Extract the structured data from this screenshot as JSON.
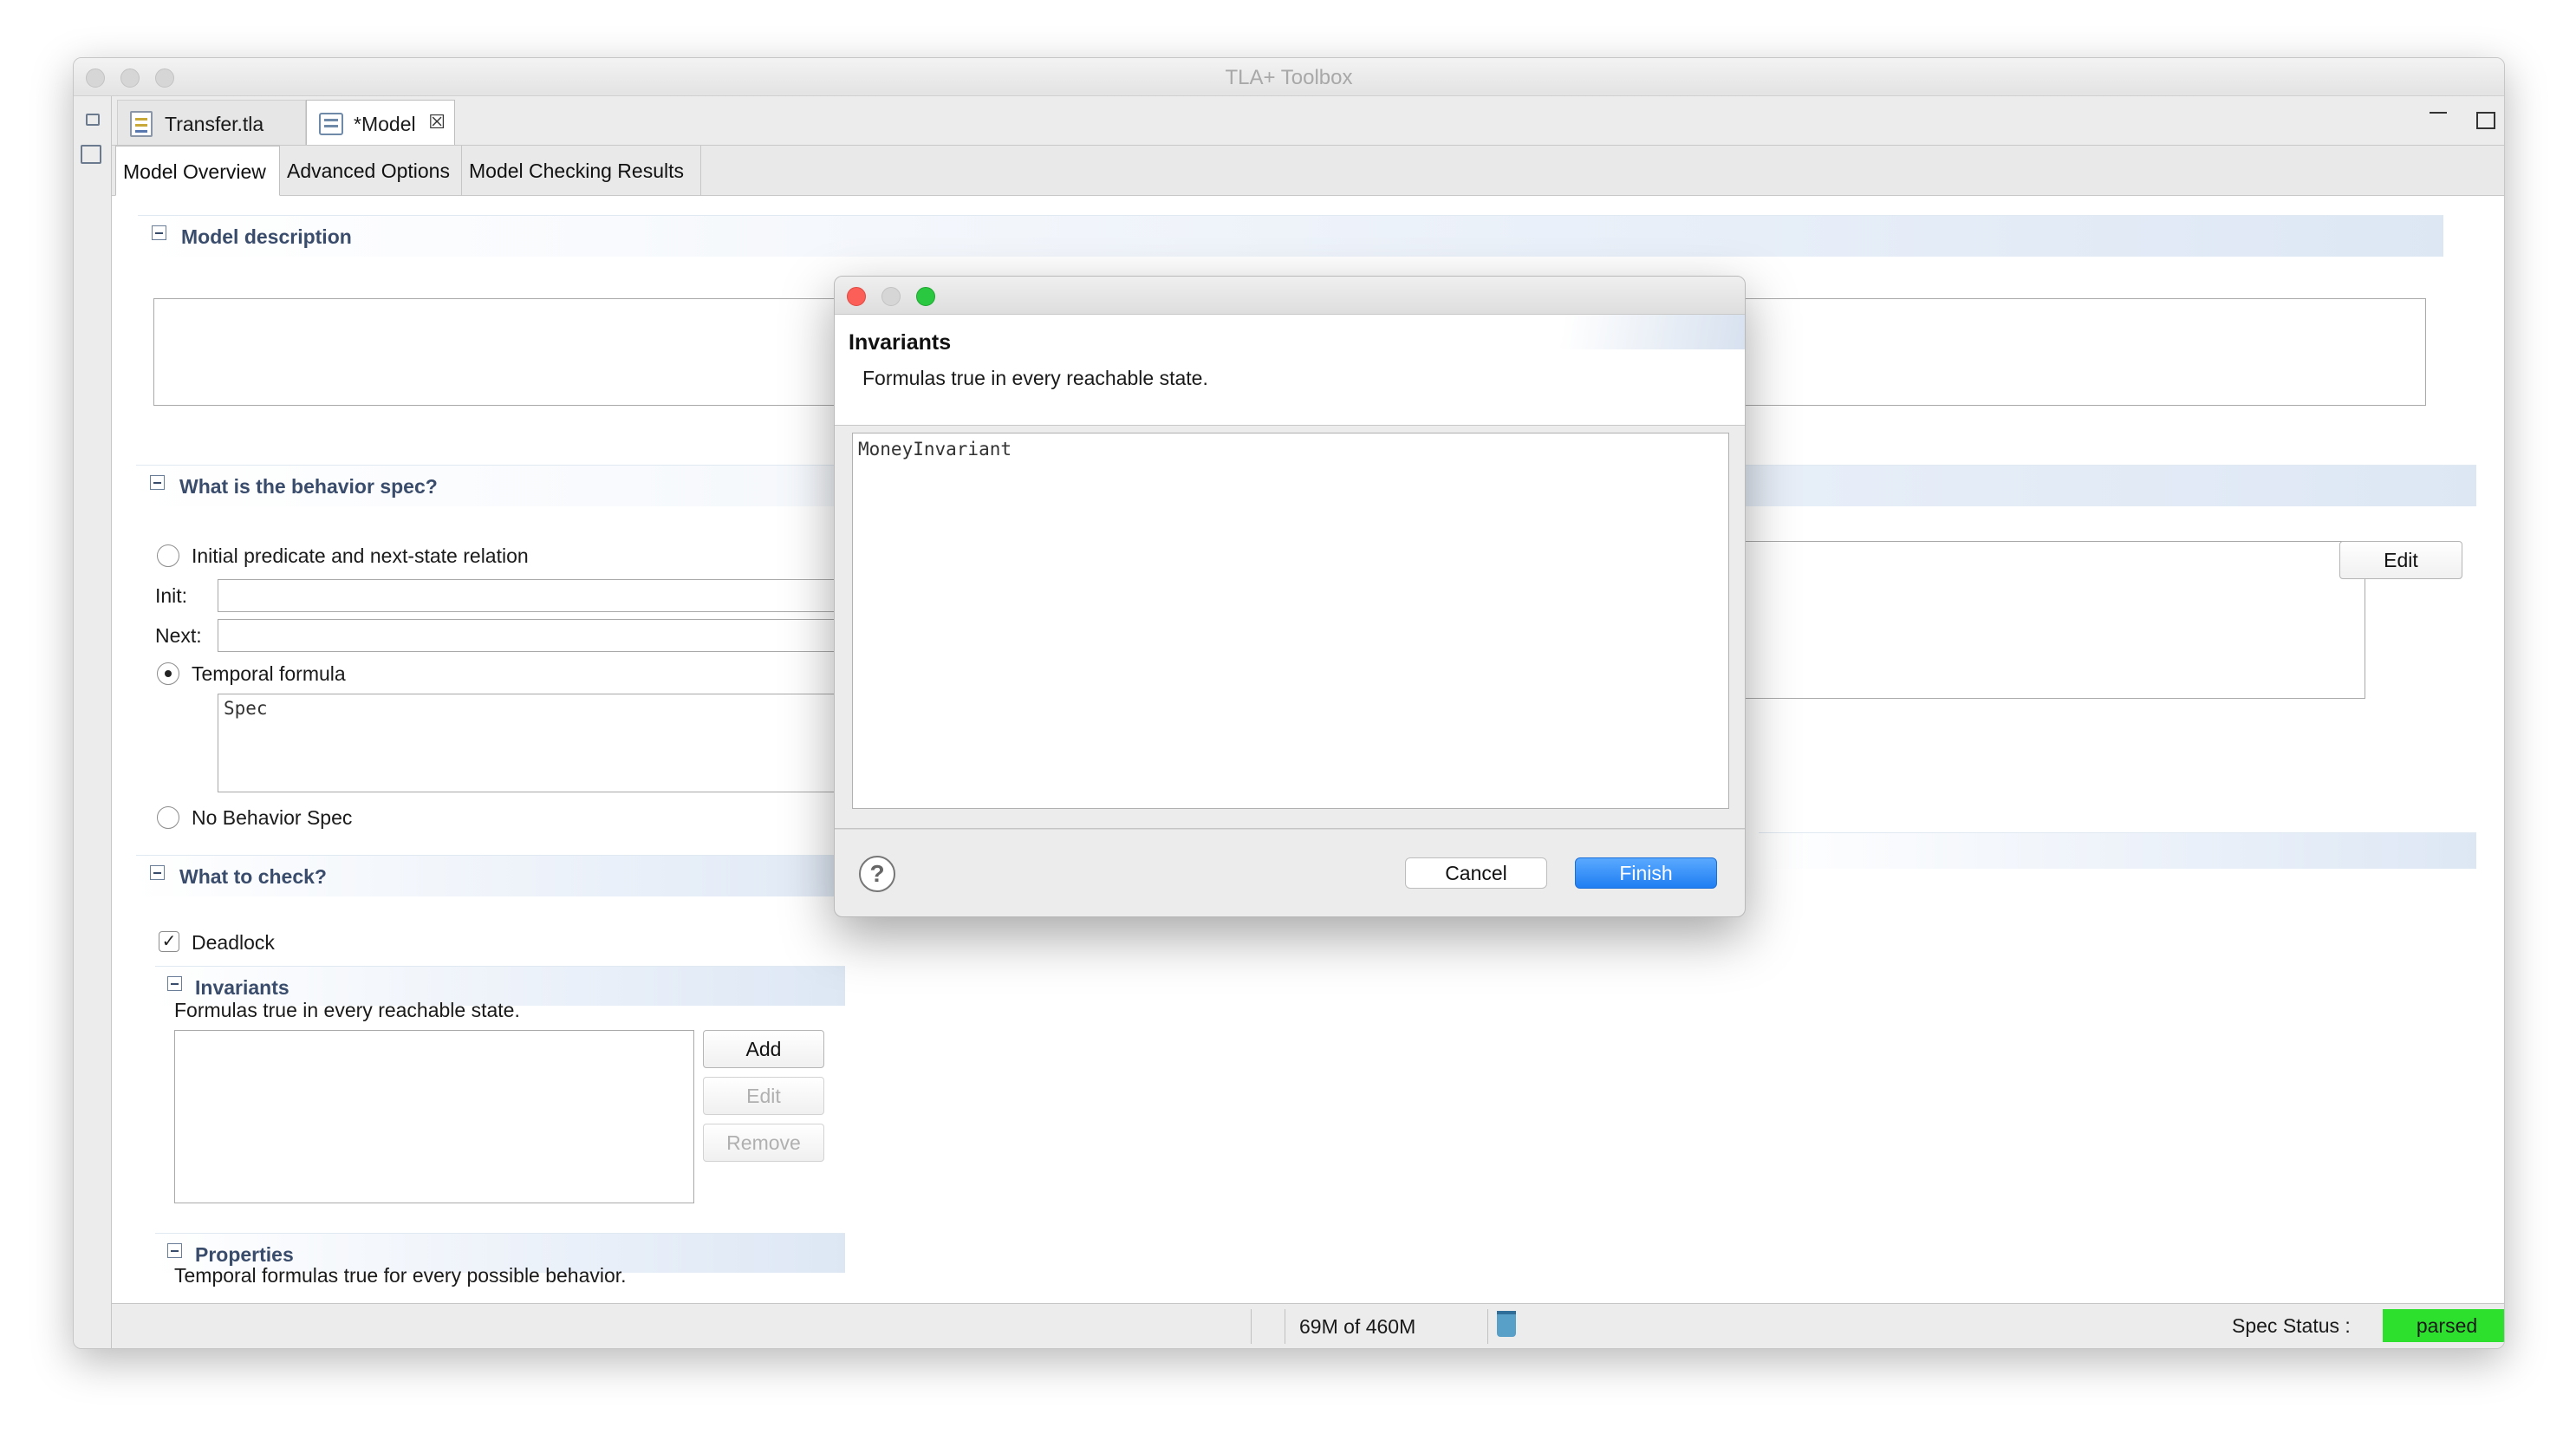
{
  "app": {
    "window_title": "TLA+ Toolbox"
  },
  "editor_tabs": [
    {
      "label": "Transfer.tla",
      "icon": "tla-file-icon"
    },
    {
      "label": "*Model",
      "icon": "model-icon",
      "active": true
    }
  ],
  "form_tabs": [
    {
      "label": "Model Overview",
      "active": true
    },
    {
      "label": "Advanced Options"
    },
    {
      "label": "Model Checking Results"
    }
  ],
  "model_description": {
    "title": "Model description"
  },
  "behavior": {
    "title": "What is the behavior spec?",
    "option_initnext": "Initial predicate and next-state relation",
    "init_label": "Init:",
    "next_label": "Next:",
    "option_temporal": "Temporal formula",
    "temporal_value": "Spec",
    "option_none": "No Behavior Spec",
    "selected": "Temporal formula"
  },
  "right_panel": {
    "edit_label": "Edit"
  },
  "check": {
    "title": "What to check?",
    "deadlock_label": "Deadlock",
    "deadlock_checked": true
  },
  "invariants_section": {
    "title": "Invariants",
    "description": "Formulas true in every reachable state.",
    "add_label": "Add",
    "edit_label": "Edit",
    "remove_label": "Remove"
  },
  "properties_section": {
    "title": "Properties",
    "description": "Temporal formulas true for every possible behavior."
  },
  "status_bar": {
    "memory": "69M of 460M",
    "spec_status_label": "Spec Status :",
    "spec_status_value": "parsed",
    "status_color": "#2ee02e"
  },
  "dialog": {
    "title": "Invariants",
    "description": "Formulas true in every reachable state.",
    "text_value": "MoneyInvariant",
    "cancel_label": "Cancel",
    "finish_label": "Finish",
    "help_glyph": "?",
    "accent_color": "#2f8cf5"
  }
}
